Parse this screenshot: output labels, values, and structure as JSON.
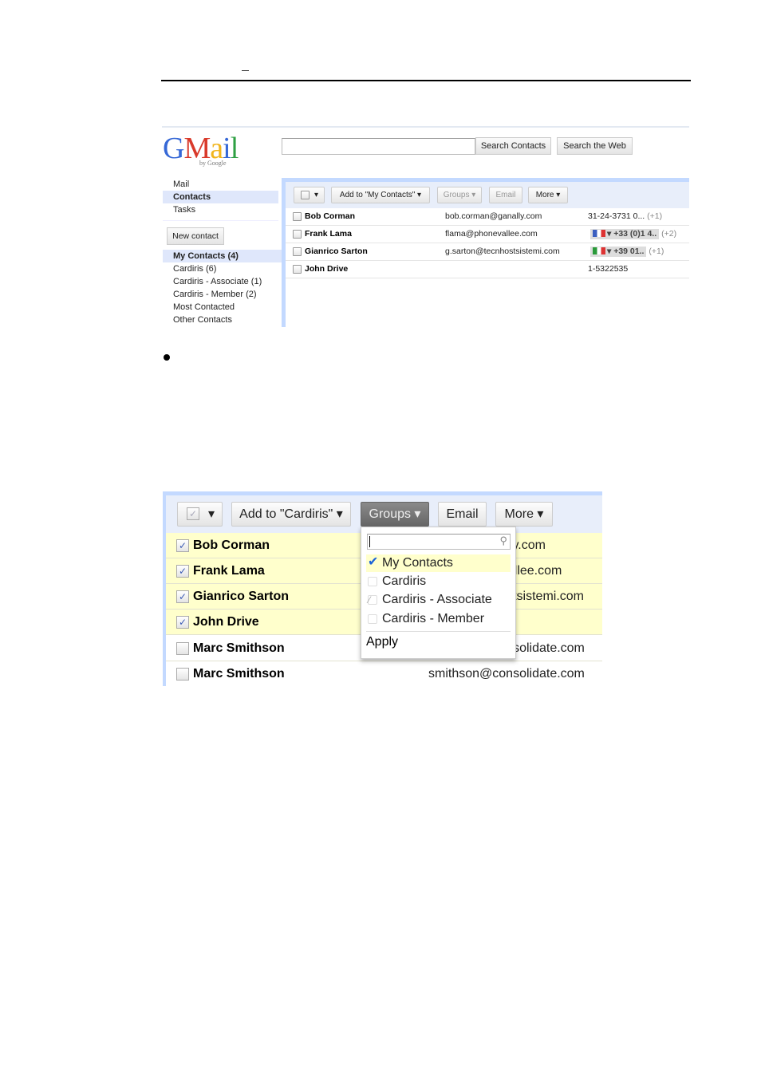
{
  "doc": {
    "header_mark": "_",
    "bullet": "•"
  },
  "shot1": {
    "logo": "Gmail",
    "logo_sub": "by Google",
    "search_value": "",
    "search_contacts": "Search Contacts",
    "search_web": "Search the Web",
    "nav": [
      "Mail",
      "Contacts",
      "Tasks"
    ],
    "new_contact": "New contact",
    "groups": [
      "My Contacts (4)",
      "Cardiris (6)",
      "Cardiris - Associate (1)",
      "Cardiris - Member (2)",
      "Most Contacted",
      "Other Contacts"
    ],
    "toolbar": {
      "select_caret": "▾",
      "add_to": "Add to \"My Contacts\" ▾",
      "groups": "Groups ▾",
      "email": "Email",
      "more": "More ▾"
    },
    "contacts": [
      {
        "name": "Bob Corman",
        "email": "bob.corman@ganally.com",
        "phone": "31-24-3731 0...",
        "extra": "(+1)"
      },
      {
        "name": "Frank Lama",
        "email": "flama@phonevallee.com",
        "phone": "+33 (0)1 4..",
        "extra": "(+2)"
      },
      {
        "name": "Gianrico Sarton",
        "email": "g.sarton@tecnhostsistemi.com",
        "phone": "+39 01..",
        "extra": "(+1)"
      },
      {
        "name": "John Drive",
        "email": "",
        "phone": "1-5322535",
        "extra": ""
      }
    ]
  },
  "shot2": {
    "toolbar": {
      "select_caret": "▾",
      "add_to": "Add to \"Cardiris\" ▾",
      "groups": "Groups ▾",
      "email": "Email",
      "more": "More ▾"
    },
    "contacts": [
      {
        "name": "Bob Corman",
        "email": "bob.corman@ganally.com",
        "checked": true
      },
      {
        "name": "Frank Lama",
        "email": "flama@phonevallee.com",
        "checked": true
      },
      {
        "name": "Gianrico Sarton",
        "email": "g.sarton@tecnhostsistemi.com",
        "checked": true
      },
      {
        "name": "John Drive",
        "email": "",
        "checked": true
      },
      {
        "name": "Marc Smithson",
        "email": "smithson@consolidate.com",
        "checked": false
      },
      {
        "name": "Marc Smithson",
        "email": "smithson@consolidate.com",
        "checked": false
      }
    ],
    "dropdown": {
      "search_value": "",
      "items": [
        {
          "label": "My Contacts",
          "state": "checked"
        },
        {
          "label": "Cardiris",
          "state": "unchecked"
        },
        {
          "label": "Cardiris - Associate",
          "state": "partial"
        },
        {
          "label": "Cardiris - Member",
          "state": "unchecked"
        }
      ],
      "apply": "Apply"
    }
  },
  "colors": {
    "accent": "#c3d9ff",
    "selected_row": "#ffffcc",
    "nav_selected": "#dfe7fb"
  }
}
